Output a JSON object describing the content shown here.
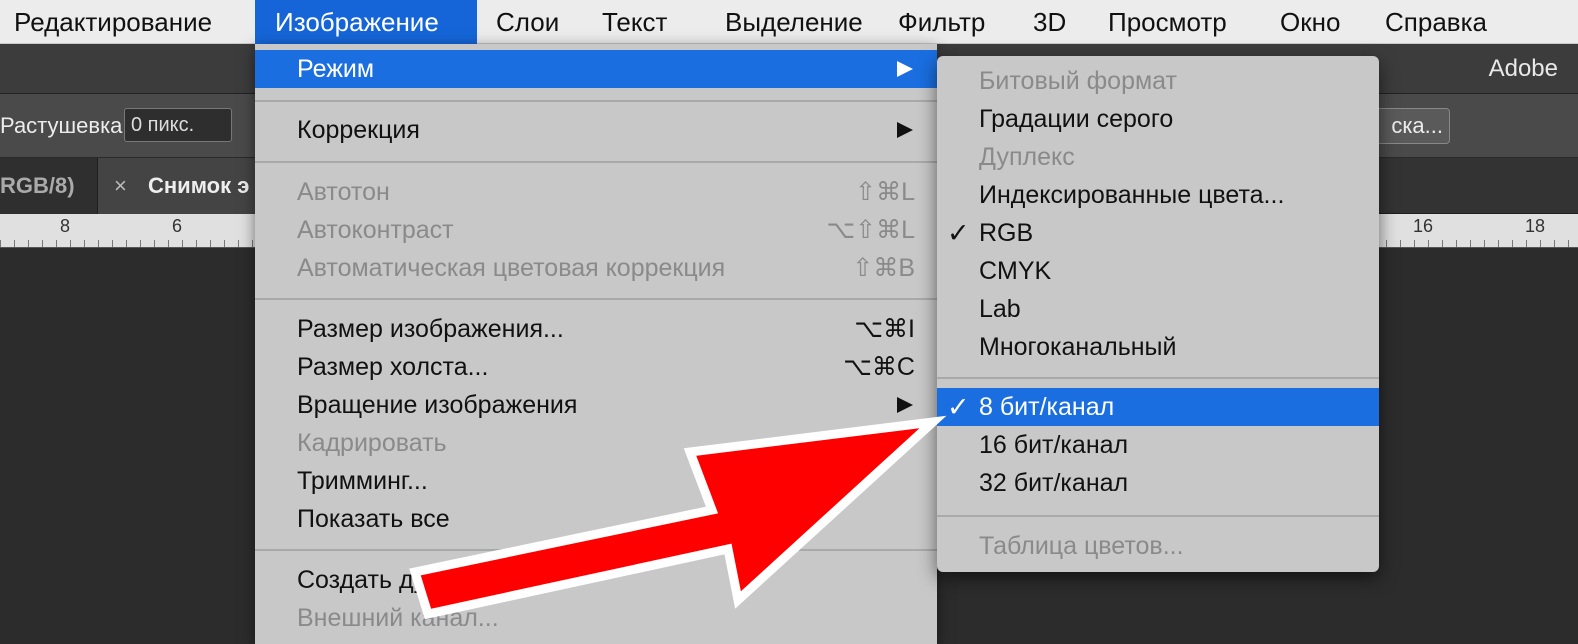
{
  "menubar": {
    "items": [
      {
        "label": "Редактирование"
      },
      {
        "label": "Изображение"
      },
      {
        "label": "Слои"
      },
      {
        "label": "Текст"
      },
      {
        "label": "Выделение"
      },
      {
        "label": "Фильтр"
      },
      {
        "label": "3D"
      },
      {
        "label": "Просмотр"
      },
      {
        "label": "Окно"
      },
      {
        "label": "Справка"
      }
    ]
  },
  "app": {
    "title": "Adobe",
    "options": {
      "feather_label": "Растушевка:",
      "feather_value": "0 пикс.",
      "right_button": "ска..."
    },
    "tabs": {
      "inactive_label": "RGB/8)",
      "active_label": "Снимок э",
      "close_glyph": "×"
    },
    "ruler": [
      "8",
      "6",
      "16",
      "18"
    ]
  },
  "menu": {
    "items": [
      {
        "label": "Режим",
        "shortcut": "",
        "submenu": true
      },
      {
        "label": "Коррекция",
        "shortcut": "",
        "submenu": true
      },
      {
        "label": "Автотон",
        "shortcut": "⇧⌘L"
      },
      {
        "label": "Автоконтраст",
        "shortcut": "⌥⇧⌘L"
      },
      {
        "label": "Автоматическая цветовая коррекция",
        "shortcut": "⇧⌘B"
      },
      {
        "label": "Размер изображения...",
        "shortcut": "⌥⌘I"
      },
      {
        "label": "Размер холста...",
        "shortcut": "⌥⌘C"
      },
      {
        "label": "Вращение изображения",
        "shortcut": "",
        "submenu": true
      },
      {
        "label": "Кадрировать",
        "shortcut": ""
      },
      {
        "label": "Тримминг...",
        "shortcut": ""
      },
      {
        "label": "Показать все",
        "shortcut": ""
      },
      {
        "label": "Создать дубликат...",
        "shortcut": ""
      },
      {
        "label": "Внешний канал...",
        "shortcut": ""
      }
    ]
  },
  "submenu": {
    "check_glyph": "✓",
    "items": [
      {
        "label": "Битовый формат"
      },
      {
        "label": "Градации серого"
      },
      {
        "label": "Дуплекс"
      },
      {
        "label": "Индексированные цвета..."
      },
      {
        "label": "RGB"
      },
      {
        "label": "CMYK"
      },
      {
        "label": "Lab"
      },
      {
        "label": "Многоканальный"
      },
      {
        "label": "8 бит/канал"
      },
      {
        "label": "16 бит/канал"
      },
      {
        "label": "32 бит/канал"
      },
      {
        "label": "Таблица цветов..."
      }
    ]
  },
  "colors": {
    "highlight": "#1a6ee0",
    "menu_bg": "#c8c8c8",
    "annotation_arrow": "#ff0000"
  }
}
